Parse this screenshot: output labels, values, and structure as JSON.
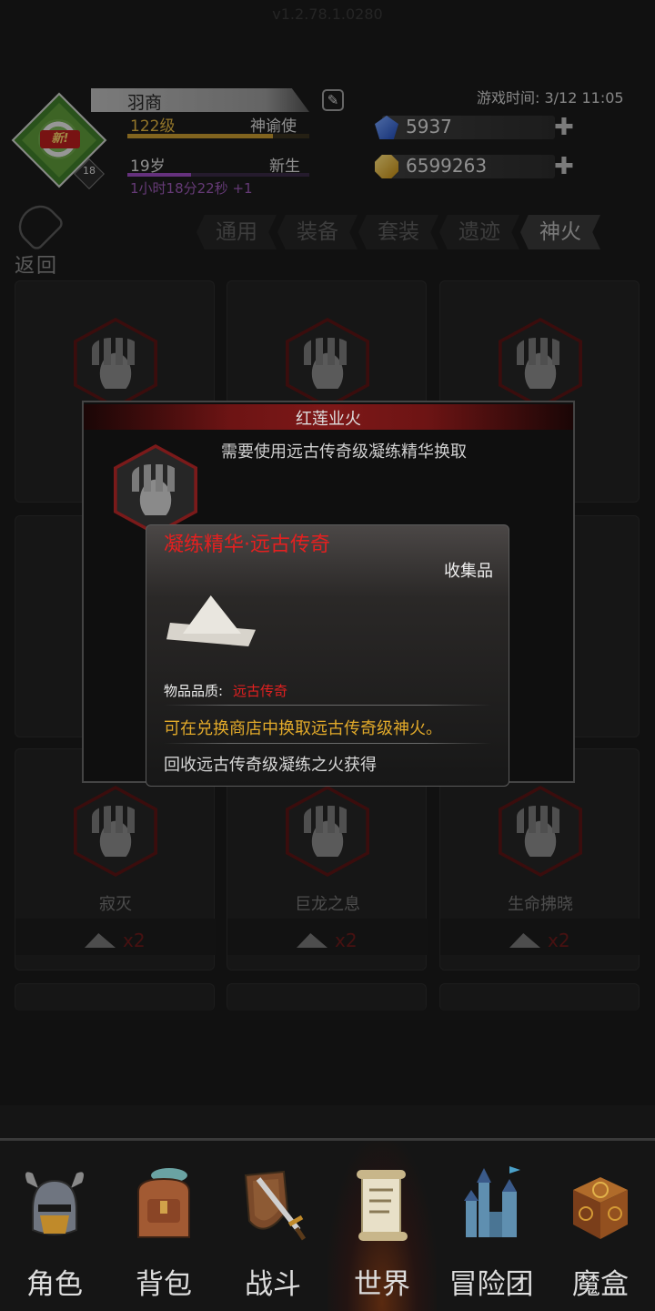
{
  "header": {
    "version": "v1.2.78.1.0280",
    "player": {
      "name": "羽商",
      "new_badge": "新!",
      "avatar_level": "18",
      "level": "122级",
      "title": "神谕使",
      "level_progress": 0.8,
      "age": "19岁",
      "age_status": "新生",
      "age_progress": 0.35,
      "timer": "1小时18分22秒 +1"
    },
    "game_time": "游戏时间: 3/12 11:05",
    "currencies": [
      {
        "icon": "blue-gem-icon",
        "value": "5937"
      },
      {
        "icon": "gold-coin-icon",
        "value": "6599263"
      }
    ]
  },
  "back_label": "返回",
  "tabs": [
    {
      "label": "通用",
      "active": false
    },
    {
      "label": "装备",
      "active": false
    },
    {
      "label": "套装",
      "active": false
    },
    {
      "label": "遗迹",
      "active": false
    },
    {
      "label": "神火",
      "active": true
    }
  ],
  "cards": [
    {
      "name": "",
      "cost": ""
    },
    {
      "name": "",
      "cost": ""
    },
    {
      "name": "",
      "cost": ""
    },
    {
      "name": "寂灭",
      "cost": "x2"
    },
    {
      "name": "巨龙之息",
      "cost": "x2"
    },
    {
      "name": "生命拂晓",
      "cost": "x2"
    }
  ],
  "popup_fire": {
    "title": "红莲业火",
    "description": "需要使用远古传奇级凝练精华换取"
  },
  "popup_item": {
    "title": "凝练精华·远古传奇",
    "type": "收集品",
    "quality_label": "物品品质:",
    "quality_value": "远古传奇",
    "line1": "可在兑换商店中换取远古传奇级神火。",
    "line2": "回收远古传奇级凝练之火获得"
  },
  "nav": [
    {
      "label": "角色",
      "icon": "helmet-icon",
      "active": false
    },
    {
      "label": "背包",
      "icon": "backpack-icon",
      "active": false
    },
    {
      "label": "战斗",
      "icon": "sword-shield-icon",
      "active": false
    },
    {
      "label": "世界",
      "icon": "scroll-map-icon",
      "active": true
    },
    {
      "label": "冒险团",
      "icon": "castle-icon",
      "active": false
    },
    {
      "label": "魔盒",
      "icon": "magic-box-icon",
      "active": false
    }
  ],
  "colors": {
    "accent_red": "#e32020",
    "gold_text": "#e2aa2a",
    "level_gold": "#e0b440",
    "timer_purple": "#9b59b6"
  }
}
